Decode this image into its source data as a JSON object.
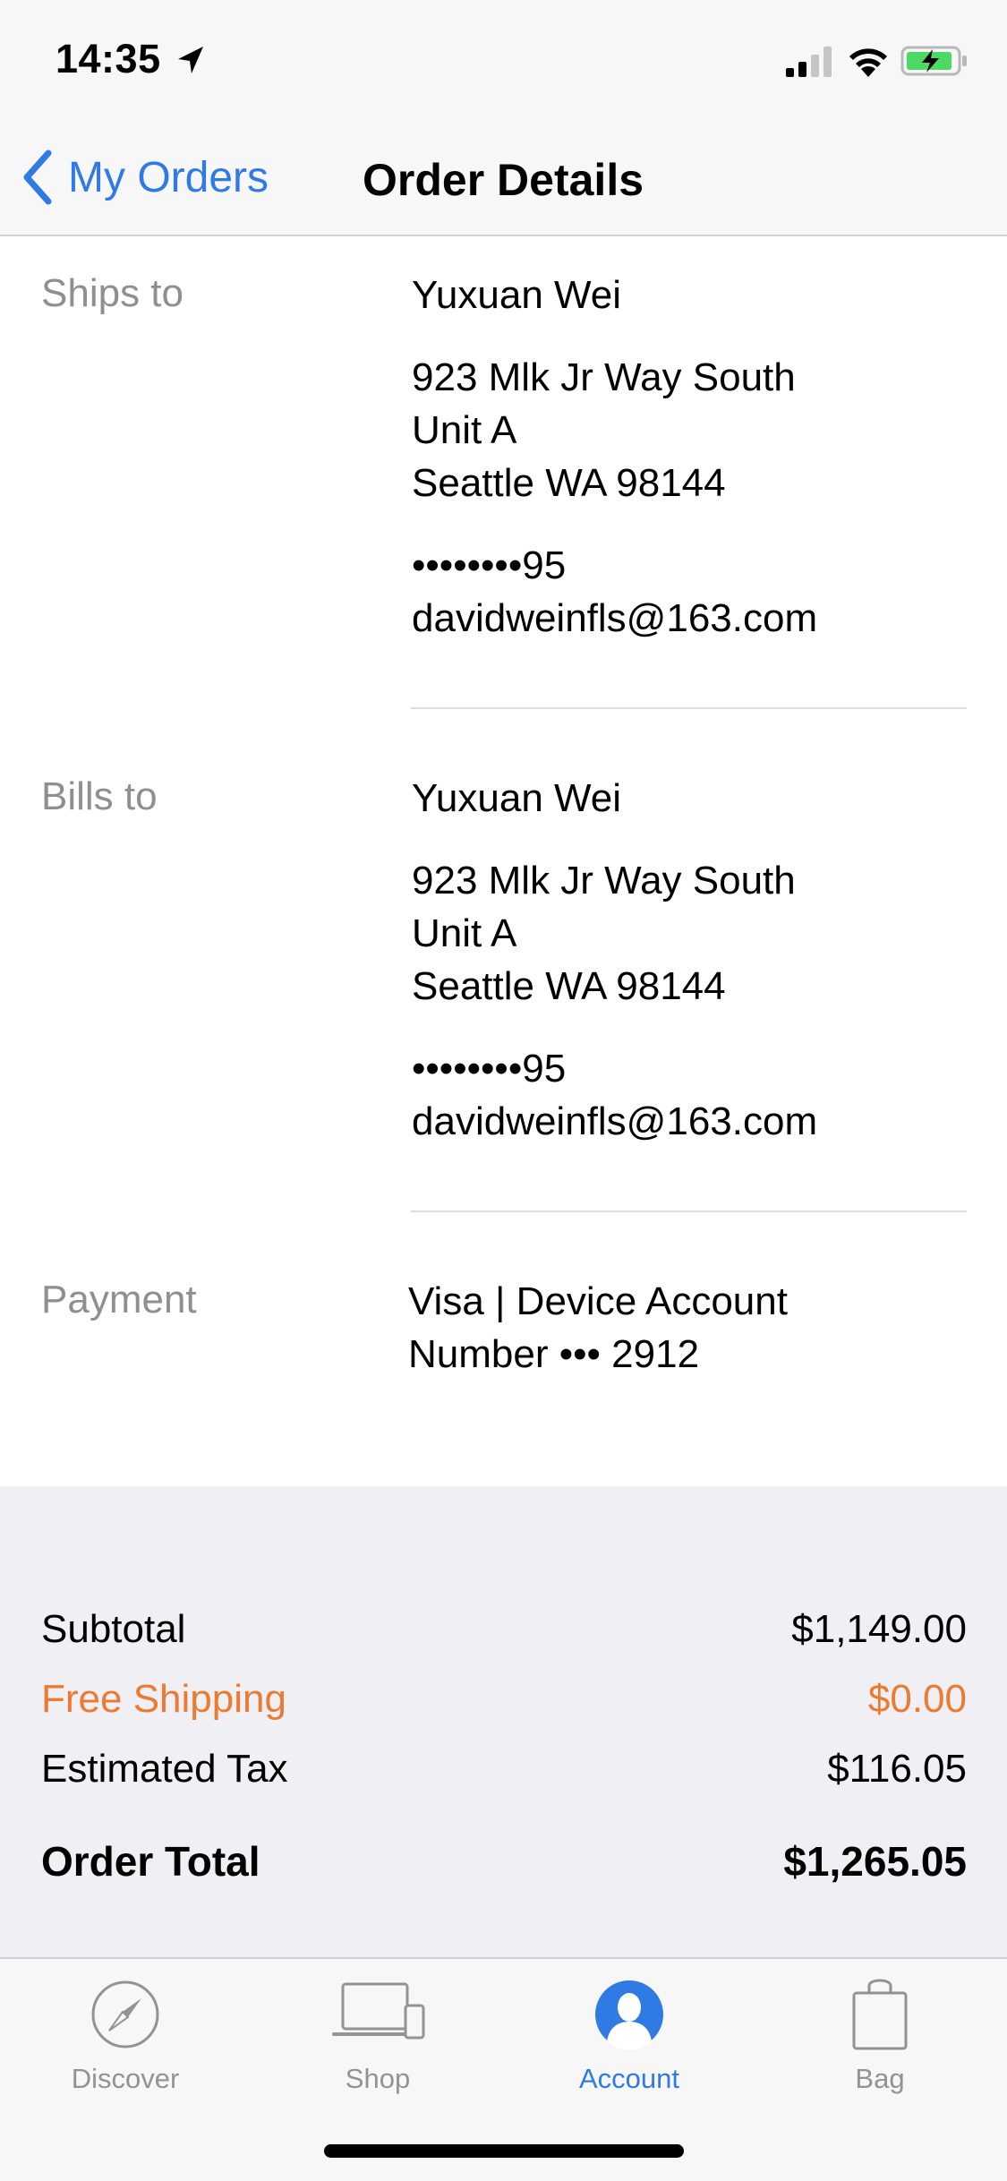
{
  "status_bar": {
    "time": "14:35",
    "icons": [
      "location-arrow-icon",
      "signal-icon",
      "wifi-icon",
      "battery-charging-icon"
    ]
  },
  "nav": {
    "back_label": "My Orders",
    "title": "Order Details"
  },
  "ships_to": {
    "label": "Ships to",
    "name": "Yuxuan Wei",
    "address_line1": "923 Mlk Jr Way South",
    "address_line2": "Unit A",
    "address_line3": "Seattle WA 98144",
    "phone": "••••••••95",
    "email": "davidweinfls@163.com"
  },
  "bills_to": {
    "label": "Bills to",
    "name": "Yuxuan Wei",
    "address_line1": "923 Mlk Jr Way South",
    "address_line2": "Unit A",
    "address_line3": "Seattle WA 98144",
    "phone": "••••••••95",
    "email": "davidweinfls@163.com"
  },
  "payment": {
    "label": "Payment",
    "line1": "Visa | Device Account",
    "line2": "Number ••• 2912"
  },
  "summary": {
    "subtotal_label": "Subtotal",
    "subtotal_value": "$1,149.00",
    "shipping_label": "Free Shipping",
    "shipping_value": "$0.00",
    "tax_label": "Estimated Tax",
    "tax_value": "$116.05",
    "total_label": "Order Total",
    "total_value": "$1,265.05"
  },
  "tabs": [
    {
      "label": "Discover",
      "icon": "compass-icon",
      "active": false
    },
    {
      "label": "Shop",
      "icon": "devices-icon",
      "active": false
    },
    {
      "label": "Account",
      "icon": "account-icon",
      "active": true
    },
    {
      "label": "Bag",
      "icon": "bag-icon",
      "active": false
    }
  ],
  "colors": {
    "accent": "#2f7ae5",
    "shipping": "#ec7a30",
    "secondary_text": "#8e8e93",
    "summary_bg": "#efeff4"
  }
}
